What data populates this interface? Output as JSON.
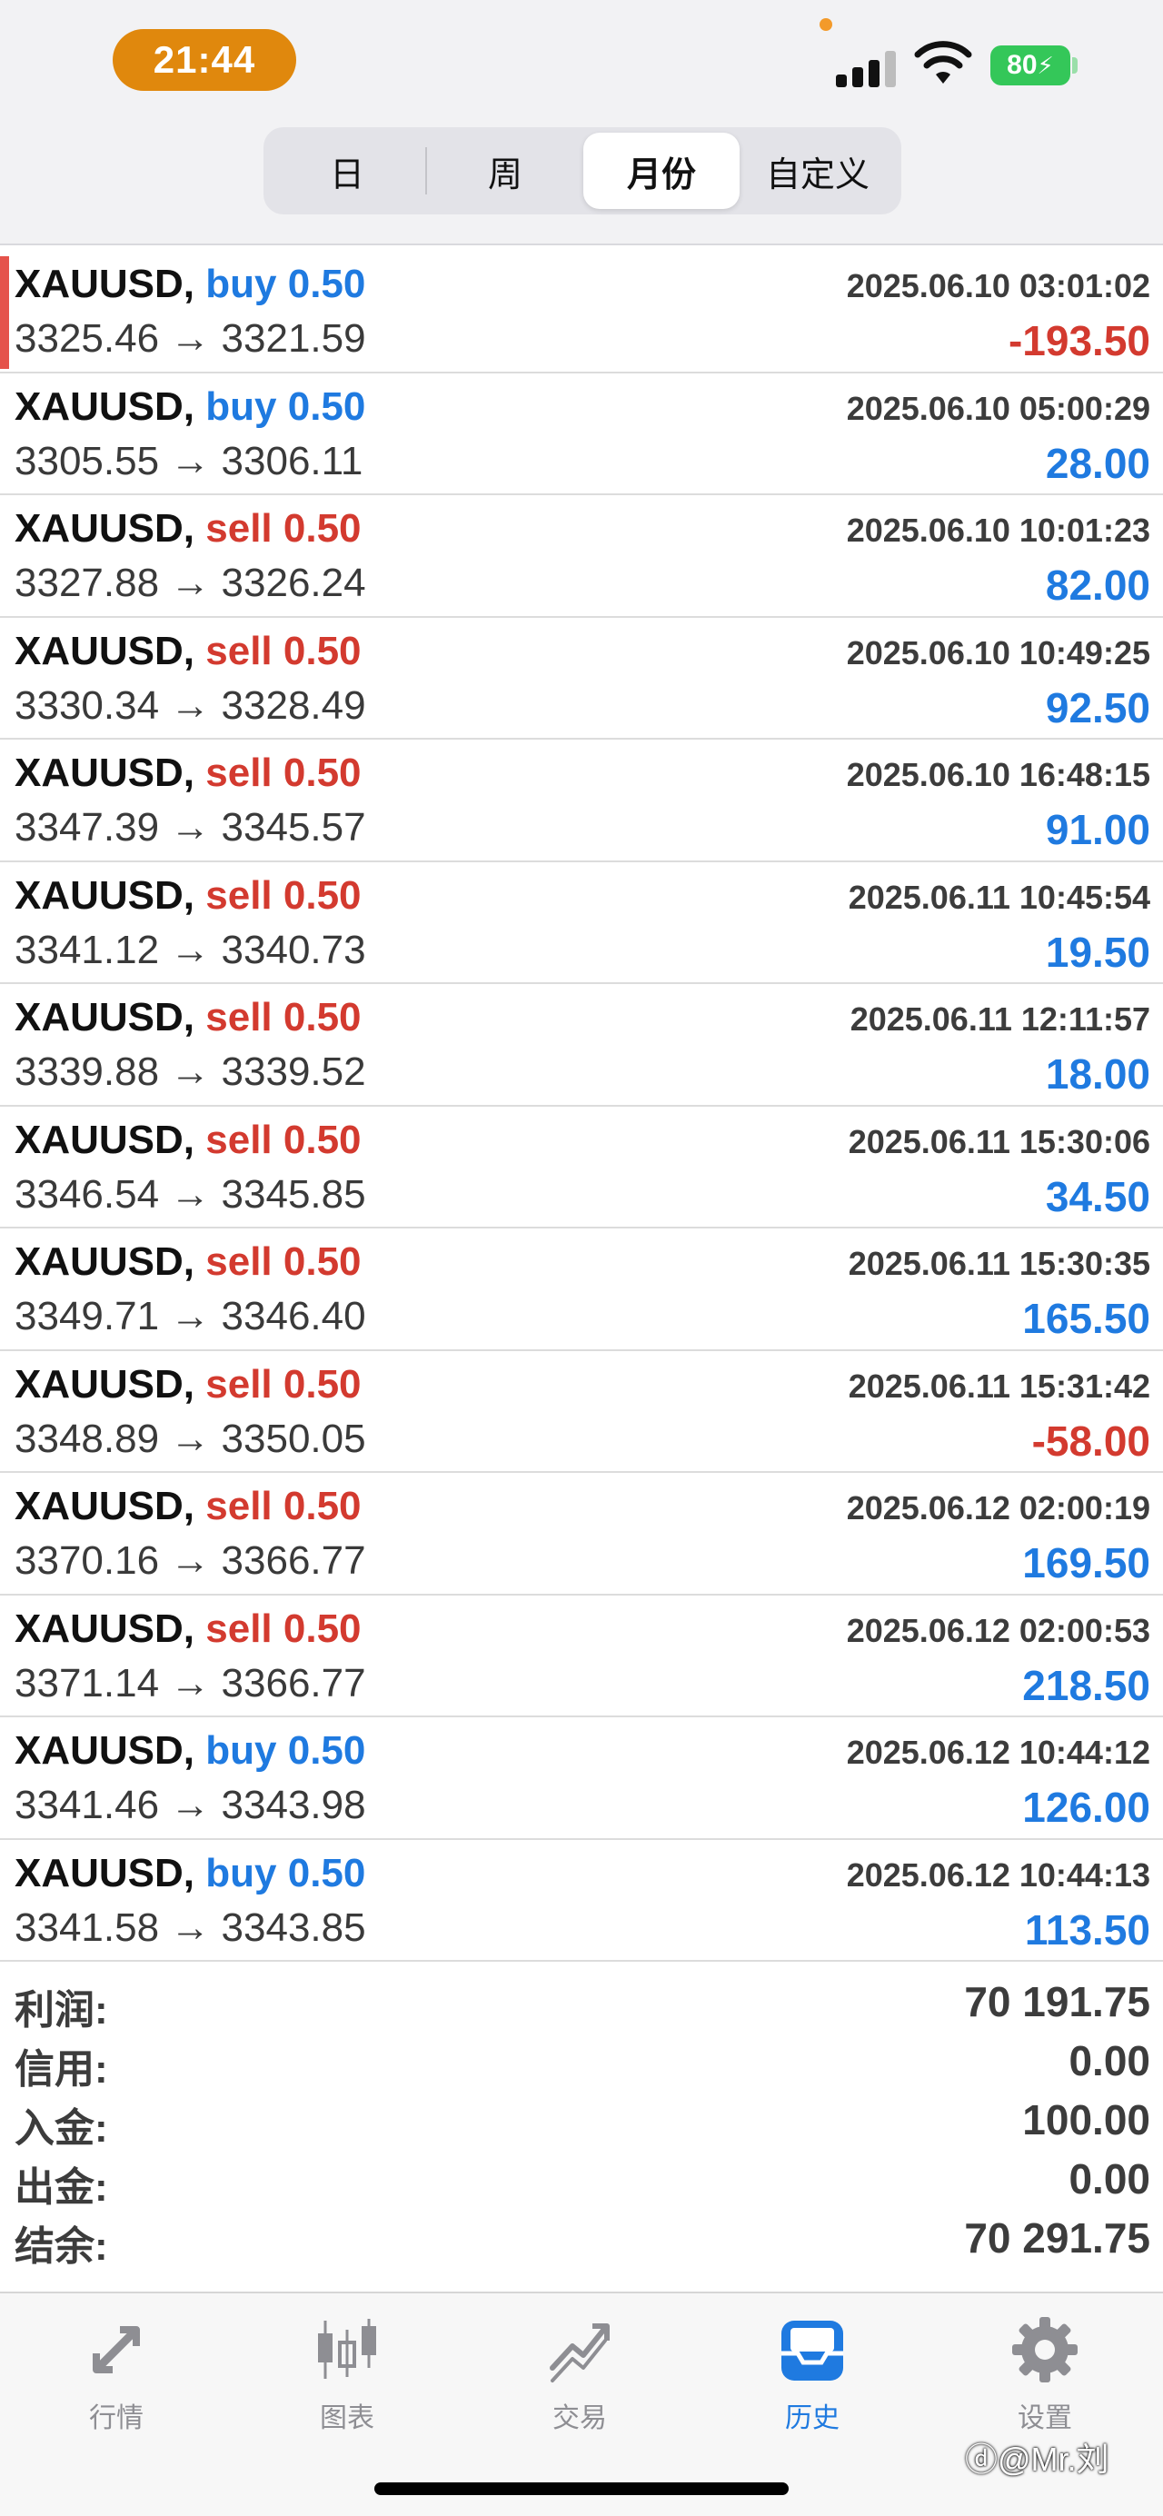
{
  "status_bar": {
    "time": "21:44",
    "battery": "80",
    "signal_icon": "cellular-signal-icon",
    "wifi_icon": "wifi-icon"
  },
  "segments": {
    "items": [
      {
        "label": "日"
      },
      {
        "label": "周"
      },
      {
        "label": "月份"
      },
      {
        "label": "自定义"
      }
    ],
    "active_index": 2
  },
  "trades": [
    {
      "symbol": "XAUUSD,",
      "side": "buy",
      "lots": "0.50",
      "time": "2025.06.10 03:01:02",
      "open": "3325.46",
      "close": "3321.59",
      "arrow": "→",
      "profit": "-193.50",
      "negative": true
    },
    {
      "symbol": "XAUUSD,",
      "side": "buy",
      "lots": "0.50",
      "time": "2025.06.10 05:00:29",
      "open": "3305.55",
      "close": "3306.11",
      "arrow": "→",
      "profit": "28.00",
      "negative": false
    },
    {
      "symbol": "XAUUSD,",
      "side": "sell",
      "lots": "0.50",
      "time": "2025.06.10 10:01:23",
      "open": "3327.88",
      "close": "3326.24",
      "arrow": "→",
      "profit": "82.00",
      "negative": false
    },
    {
      "symbol": "XAUUSD,",
      "side": "sell",
      "lots": "0.50",
      "time": "2025.06.10 10:49:25",
      "open": "3330.34",
      "close": "3328.49",
      "arrow": "→",
      "profit": "92.50",
      "negative": false
    },
    {
      "symbol": "XAUUSD,",
      "side": "sell",
      "lots": "0.50",
      "time": "2025.06.10 16:48:15",
      "open": "3347.39",
      "close": "3345.57",
      "arrow": "→",
      "profit": "91.00",
      "negative": false
    },
    {
      "symbol": "XAUUSD,",
      "side": "sell",
      "lots": "0.50",
      "time": "2025.06.11 10:45:54",
      "open": "3341.12",
      "close": "3340.73",
      "arrow": "→",
      "profit": "19.50",
      "negative": false
    },
    {
      "symbol": "XAUUSD,",
      "side": "sell",
      "lots": "0.50",
      "time": "2025.06.11 12:11:57",
      "open": "3339.88",
      "close": "3339.52",
      "arrow": "→",
      "profit": "18.00",
      "negative": false
    },
    {
      "symbol": "XAUUSD,",
      "side": "sell",
      "lots": "0.50",
      "time": "2025.06.11 15:30:06",
      "open": "3346.54",
      "close": "3345.85",
      "arrow": "→",
      "profit": "34.50",
      "negative": false
    },
    {
      "symbol": "XAUUSD,",
      "side": "sell",
      "lots": "0.50",
      "time": "2025.06.11 15:30:35",
      "open": "3349.71",
      "close": "3346.40",
      "arrow": "→",
      "profit": "165.50",
      "negative": false
    },
    {
      "symbol": "XAUUSD,",
      "side": "sell",
      "lots": "0.50",
      "time": "2025.06.11 15:31:42",
      "open": "3348.89",
      "close": "3350.05",
      "arrow": "→",
      "profit": "-58.00",
      "negative": true
    },
    {
      "symbol": "XAUUSD,",
      "side": "sell",
      "lots": "0.50",
      "time": "2025.06.12 02:00:19",
      "open": "3370.16",
      "close": "3366.77",
      "arrow": "→",
      "profit": "169.50",
      "negative": false
    },
    {
      "symbol": "XAUUSD,",
      "side": "sell",
      "lots": "0.50",
      "time": "2025.06.12 02:00:53",
      "open": "3371.14",
      "close": "3366.77",
      "arrow": "→",
      "profit": "218.50",
      "negative": false
    },
    {
      "symbol": "XAUUSD,",
      "side": "buy",
      "lots": "0.50",
      "time": "2025.06.12 10:44:12",
      "open": "3341.46",
      "close": "3343.98",
      "arrow": "→",
      "profit": "126.00",
      "negative": false
    },
    {
      "symbol": "XAUUSD,",
      "side": "buy",
      "lots": "0.50",
      "time": "2025.06.12 10:44:13",
      "open": "3341.58",
      "close": "3343.85",
      "arrow": "→",
      "profit": "113.50",
      "negative": false
    }
  ],
  "summary": [
    {
      "label": "利润:",
      "value": "70 191.75"
    },
    {
      "label": "信用:",
      "value": "0.00"
    },
    {
      "label": "入金:",
      "value": "100.00"
    },
    {
      "label": "出金:",
      "value": "0.00"
    },
    {
      "label": "结余:",
      "value": "70 291.75"
    }
  ],
  "tabbar": {
    "items": [
      {
        "label": "行情",
        "icon": "quotes-arrows-icon"
      },
      {
        "label": "图表",
        "icon": "candlestick-chart-icon"
      },
      {
        "label": "交易",
        "icon": "trade-trend-icon"
      },
      {
        "label": "历史",
        "icon": "history-inbox-icon"
      },
      {
        "label": "设置",
        "icon": "gear-icon"
      }
    ],
    "active_index": 3
  },
  "watermark": "@Mr.刘",
  "colors": {
    "buy": "#1f7ae0",
    "sell": "#d33a2f",
    "accent": "#1f7ae0",
    "time_pill": "#e0880d",
    "battery": "#34c759"
  }
}
